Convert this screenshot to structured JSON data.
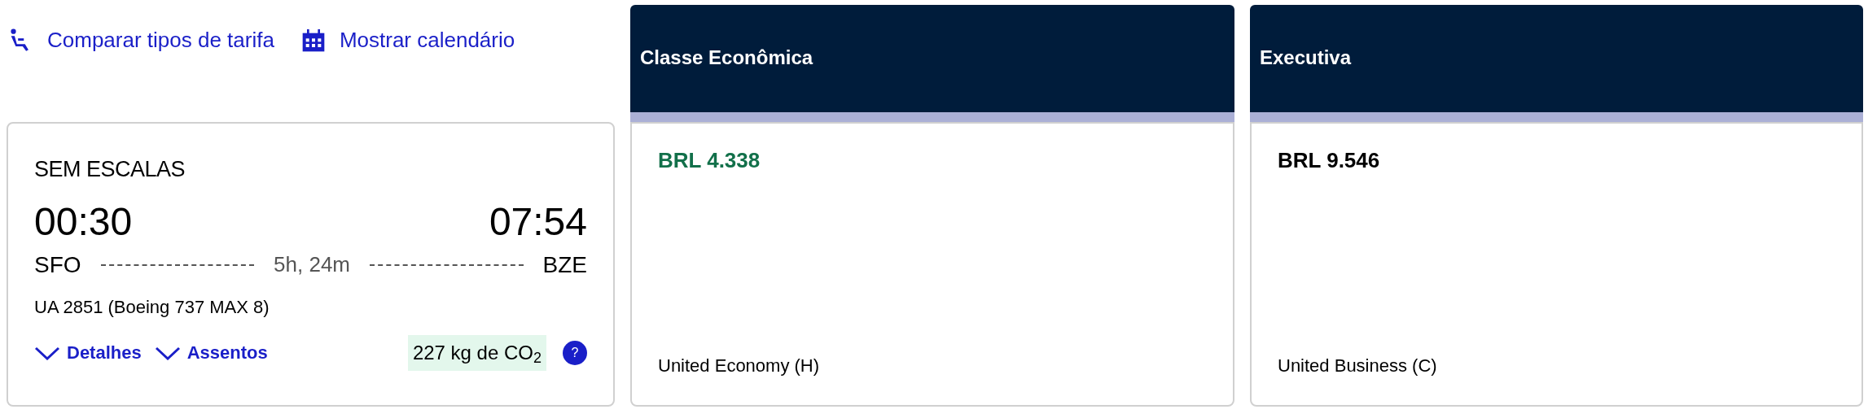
{
  "links": [
    {
      "kind": "seat",
      "label": "Comparar tipos de tarifa"
    },
    {
      "kind": "calendar",
      "label": "Mostrar calendário"
    }
  ],
  "flight": {
    "stops": "SEM ESCALAS",
    "departure_time": "00:30",
    "arrival_time": "07:54",
    "origin": "SFO",
    "duration": "5h, 24m",
    "destination": "BZE",
    "flight_info": "UA 2851 (Boeing 737 MAX 8)",
    "toggles": [
      {
        "label": "Detalhes",
        "expanded": false
      },
      {
        "label": "Assentos",
        "expanded": false
      }
    ],
    "emissions": "227 kg de CO$_{2}$",
    "help": "?"
  },
  "fares": [
    {
      "title": "Classe Econômica",
      "price": "BRL 4.338",
      "lowest": true,
      "fare_name": "United Economy (H)"
    },
    {
      "title": "Executiva",
      "price": "BRL 9.546",
      "lowest": false,
      "fare_name": "United Business (C)"
    }
  ]
}
